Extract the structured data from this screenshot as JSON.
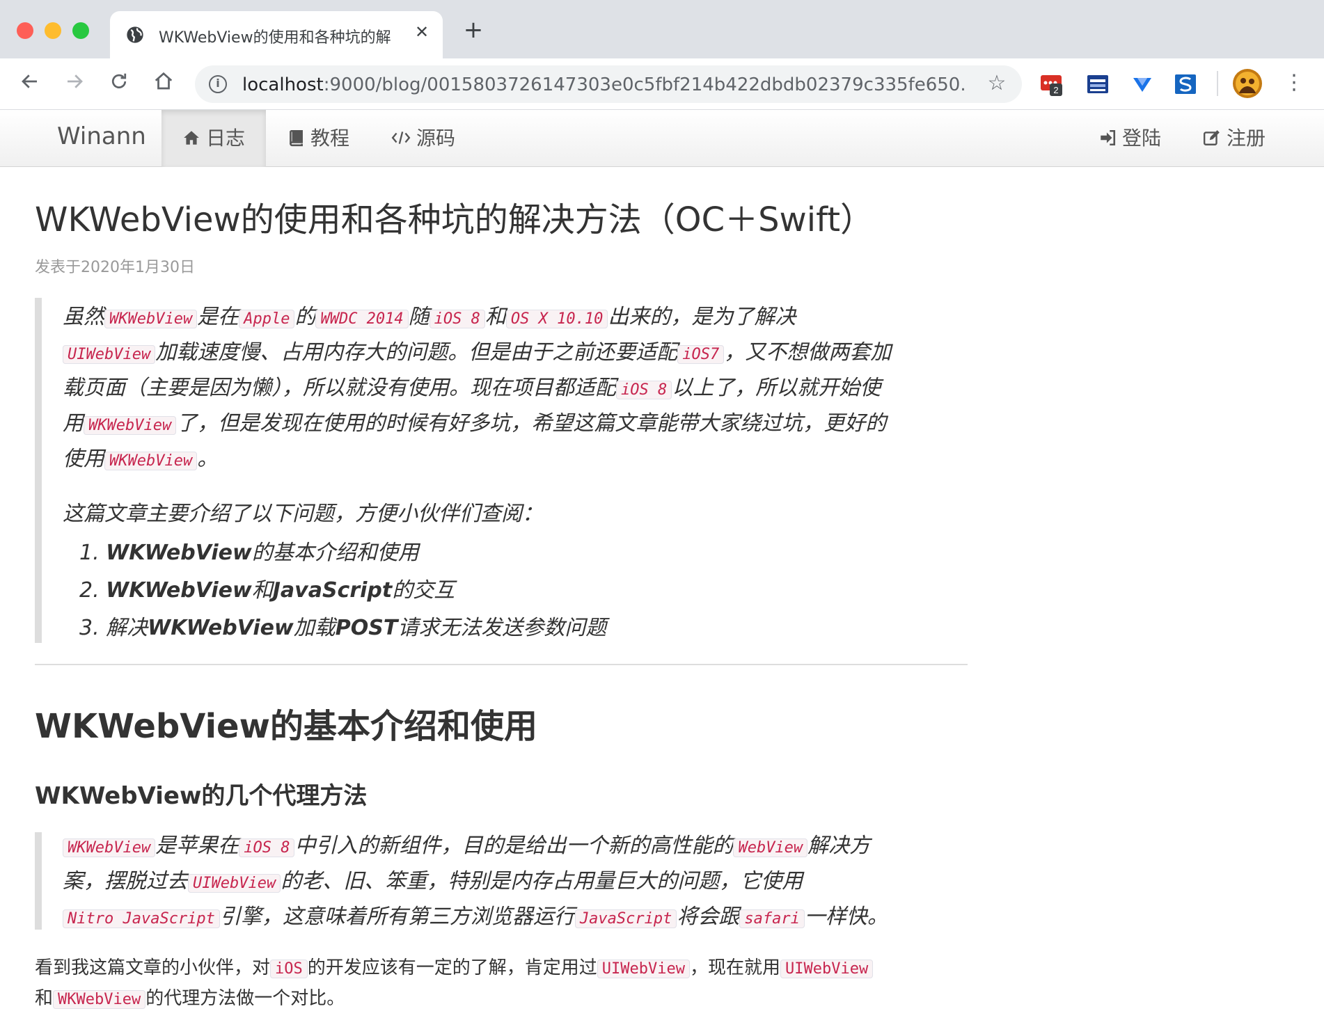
{
  "browser": {
    "tab_title": "WKWebView的使用和各种坑的解",
    "url_host": "localhost",
    "url_rest": ":9000/blog/0015803726147303e0c5fbf214b422dbdb02379c335fe650...",
    "extension_badge": "2"
  },
  "navbar": {
    "brand": "Winann",
    "items": [
      {
        "label": "日志",
        "icon": "home-icon"
      },
      {
        "label": "教程",
        "icon": "book-icon"
      },
      {
        "label": "源码",
        "icon": "code-icon"
      }
    ],
    "login": "登陆",
    "register": "注册"
  },
  "post": {
    "title": "WKWebView的使用和各种坑的解决方法（OC＋Swift）",
    "date": "发表于2020年1月30日",
    "intro": {
      "t1": "虽然",
      "c1": "WKWebView",
      "t2": "是在",
      "c2": "Apple",
      "t3": "的",
      "c3": "WWDC 2014",
      "t4": "随",
      "c4": "iOS 8",
      "t5": "和",
      "c5": "OS X 10.10",
      "t6": "出来的，是为了解决",
      "c6": "UIWebView",
      "t7": "加载速度慢、占用内存大的问题。但是由于之前还要适配",
      "c7": "iOS7",
      "t8": "，又不想做两套加",
      "t9": "载页面（主要是因为懒），所以就没有使用。现在项目都适配",
      "c8": "iOS 8",
      "t10": "以上了，所以就开始使",
      "t11": "用",
      "c9": "WKWebView",
      "t12": "了，但是发现在使用的时候有好多坑，希望这篇文章能带大家绕过坑，更好的",
      "t13": "使用",
      "c10": "WKWebView",
      "t14": "。"
    },
    "intro2": "这篇文章主要介绍了以下问题，方便小伙伴们查阅：",
    "toc": [
      {
        "num": "1.",
        "b1": "WKWebView",
        "t1": "的基本介绍和使用"
      },
      {
        "num": "2.",
        "b1": "WKWebView",
        "t1": "和",
        "b2": "JavaScript",
        "t2": "的交互"
      },
      {
        "num": "3.",
        "t0": "解决",
        "b1": "WKWebView",
        "t1": "加载",
        "b2": "POST",
        "t2": "请求无法发送参数问题"
      }
    ],
    "section_title": "WKWebView的基本介绍和使用",
    "sub_b": "WKWebView",
    "sub_t": "的几个代理方法",
    "quote2": {
      "c1": "WKWebView",
      "t1": "是苹果在",
      "c2": "iOS 8",
      "t2": "中引入的新组件，目的是给出一个新的高性能的",
      "c3": "WebView",
      "t3": "解决方",
      "t4": "案，摆脱过去",
      "c4": "UIWebView",
      "t5": "的老、旧、笨重，特别是内存占用量巨大的问题，它使用",
      "c5": "Nitro JavaScript",
      "t6": "引擎，这意味着所有第三方浏览器运行",
      "c6": "JavaScript",
      "t7": "将会跟",
      "c7": "safari",
      "t8": "一样快。"
    },
    "body": {
      "t1": "看到我这篇文章的小伙伴，对",
      "c1": "iOS",
      "t2": "的开发应该有一定的了解，肯定用过",
      "c2": "UIWebView",
      "t3": "，现在就用",
      "c3": "UIWebView",
      "t4": "和",
      "c4": "WKWebView",
      "t5": "的代理方法做一个对比。"
    }
  }
}
